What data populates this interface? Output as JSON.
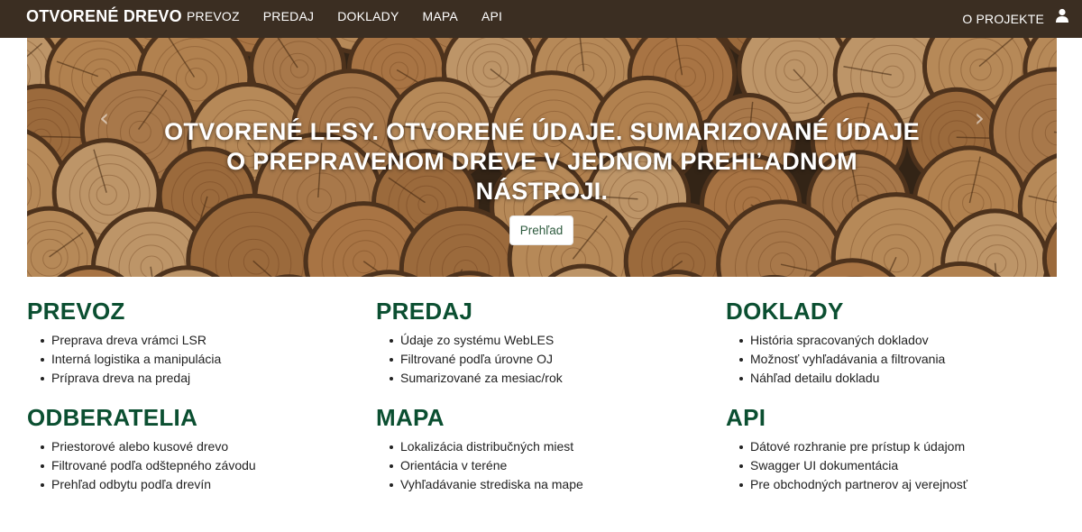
{
  "navbar": {
    "brand": "OTVORENÉ DREVO",
    "links": [
      "PREVOZ",
      "PREDAJ",
      "DOKLADY",
      "MAPA",
      "API"
    ],
    "about": "O PROJEKTE",
    "user_icon": "user-icon"
  },
  "hero": {
    "headline_line1": "Otvorené lesy. Otvorené údaje. Sumarizované údaje",
    "headline_line2": "o prepravenom dreve v jednom prehľadnom",
    "headline_line3": "nástroji.",
    "button": "Prehľad",
    "prev_arrow": "‹",
    "next_arrow": "›"
  },
  "sections": [
    {
      "title": "PREVOZ",
      "items": [
        "Preprava dreva vrámci LSR",
        "Interná logistika a manipulácia",
        "Príprava dreva na predaj"
      ]
    },
    {
      "title": "PREDAJ",
      "items": [
        "Údaje zo systému WebLES",
        "Filtrované podľa úrovne OJ",
        "Sumarizované za mesiac/rok"
      ]
    },
    {
      "title": "DOKLADY",
      "items": [
        "História spracovaných dokladov",
        "Možnosť vyhľadávania a filtrovania",
        "Náhľad detailu dokladu"
      ]
    },
    {
      "title": "ODBERATELIA",
      "items": [
        "Priestorové alebo kusové drevo",
        "Filtrované podľa odštepného závodu",
        "Prehľad odbytu podľa drevín"
      ]
    },
    {
      "title": "MAPA",
      "items": [
        "Lokalizácia distribučných miest",
        "Orientácia v teréne",
        "Vyhľadávanie strediska na mape"
      ]
    },
    {
      "title": "API",
      "items": [
        "Dátové rozhranie pre prístup k údajom",
        "Swagger UI dokumentácia",
        "Pre obchodných partnerov aj verejnosť"
      ]
    }
  ],
  "colors": {
    "navbar_bg": "#3b2e22",
    "section_title": "#0b4f31",
    "button_text": "#2e5b3f"
  }
}
